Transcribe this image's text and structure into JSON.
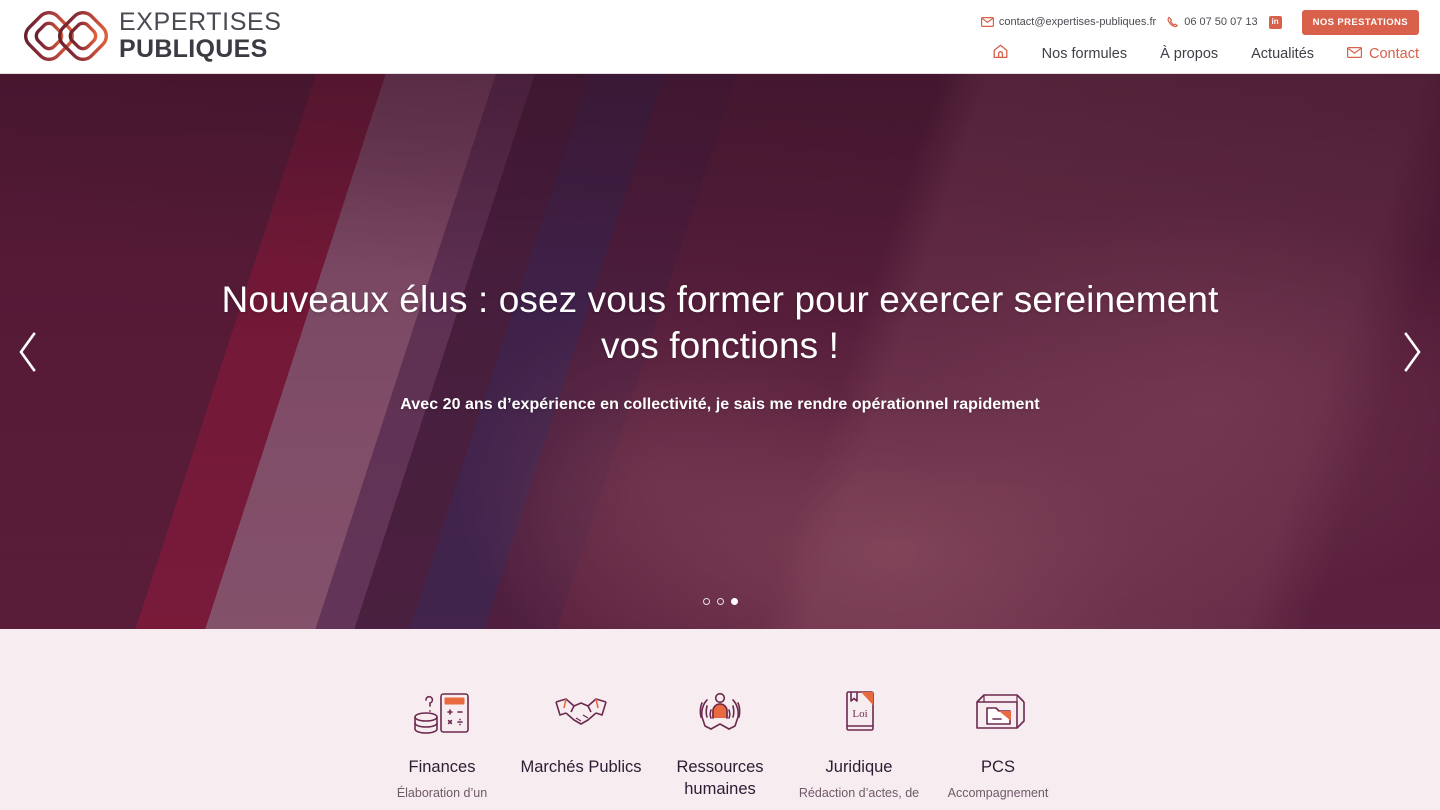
{
  "header": {
    "logo": {
      "line1": "EXPERTISES",
      "line2": "PUBLIQUES",
      "icon": "interlocking-squares-logo"
    },
    "topbar": {
      "email_icon": "envelope-icon",
      "email": "contact@expertises-publiques.fr",
      "phone_icon": "phone-icon",
      "phone": "06 07 50 07 13",
      "linkedin_icon": "linkedin-icon",
      "linkedin_label": "in",
      "cta_label": "NOS PRESTATIONS"
    },
    "nav": {
      "home_icon": "home-icon",
      "items": [
        {
          "label": "Nos formules",
          "accent": false
        },
        {
          "label": "À propos",
          "accent": false
        },
        {
          "label": "Actualités",
          "accent": false
        },
        {
          "label": "Contact",
          "accent": true,
          "icon": "envelope-icon"
        }
      ]
    }
  },
  "hero": {
    "title": "Nouveaux élus : osez vous former pour exercer sereinement vos fonctions !",
    "subtitle": "Avec 20 ans d’expérience en collectivité, je sais me rendre opérationnel rapidement",
    "prev_icon": "chevron-left-icon",
    "next_icon": "chevron-right-icon",
    "slides": [
      {
        "active": false
      },
      {
        "active": false
      },
      {
        "active": true
      }
    ]
  },
  "services": {
    "items": [
      {
        "label": "Finances",
        "desc": "Élaboration d’un",
        "icon": "calculator-coins-icon"
      },
      {
        "label": "Marchés Publics",
        "desc": "",
        "icon": "handshake-icon"
      },
      {
        "label": "Ressources humaines",
        "desc": "",
        "icon": "hands-person-icon"
      },
      {
        "label": "Juridique",
        "desc": "Rédaction d’actes, de",
        "icon": "law-book-icon",
        "icon_text": "Loi"
      },
      {
        "label": "PCS",
        "desc": "Accompagnement",
        "icon": "archive-box-icon"
      }
    ]
  },
  "colors": {
    "accent": "#d9604a",
    "hero_tint": "#6b2a4f",
    "services_bg": "#f7ecef",
    "logo_dark": "#6d2230",
    "logo_light": "#e2603f"
  }
}
